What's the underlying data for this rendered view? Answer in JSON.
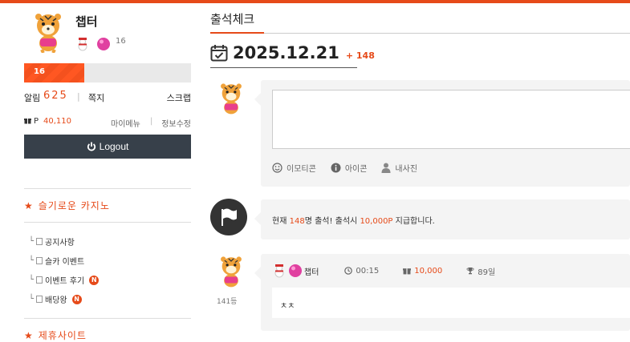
{
  "profile": {
    "nickname": "챕터",
    "level_small": "16",
    "level": "16",
    "level_progress": 0.36,
    "alarm_label": "알림",
    "alarm_count": "625",
    "memo_label": "쪽지",
    "scrap_label": "스크랩",
    "points_label": "P",
    "points": "40,110",
    "mymenu_label": "마이메뉴",
    "editinfo_label": "정보수정",
    "logout_label": "Logout"
  },
  "sidebar": {
    "section1_title": "슬기로운 카지노",
    "menu": [
      {
        "label": "공지사항",
        "new": ""
      },
      {
        "label": "슬카 이벤트",
        "new": ""
      },
      {
        "label": "이벤트 후기",
        "new": "N"
      },
      {
        "label": "배당왕",
        "new": "N"
      }
    ],
    "section2_title": "제휴사이트",
    "star": "★",
    "tree": "└"
  },
  "main": {
    "title": "출석체크",
    "date": "2025.12.21",
    "plus": "+ 148",
    "tools": {
      "emoticon": "이모티콘",
      "icon": "아이콘",
      "photo": "내사진"
    },
    "notice": {
      "prefix": "현재 ",
      "count": "148",
      "middle": "명 출석! 출석시 ",
      "points": "10,000P",
      "suffix": " 지급합니다."
    },
    "entry": {
      "nickname": "챕터",
      "time": "00:15",
      "points": "10,000",
      "days": "89일",
      "comment": "ㅊㅊ",
      "rank": "141등"
    }
  },
  "colors": {
    "accent": "#e64a19",
    "logout_bg": "#37404a"
  }
}
